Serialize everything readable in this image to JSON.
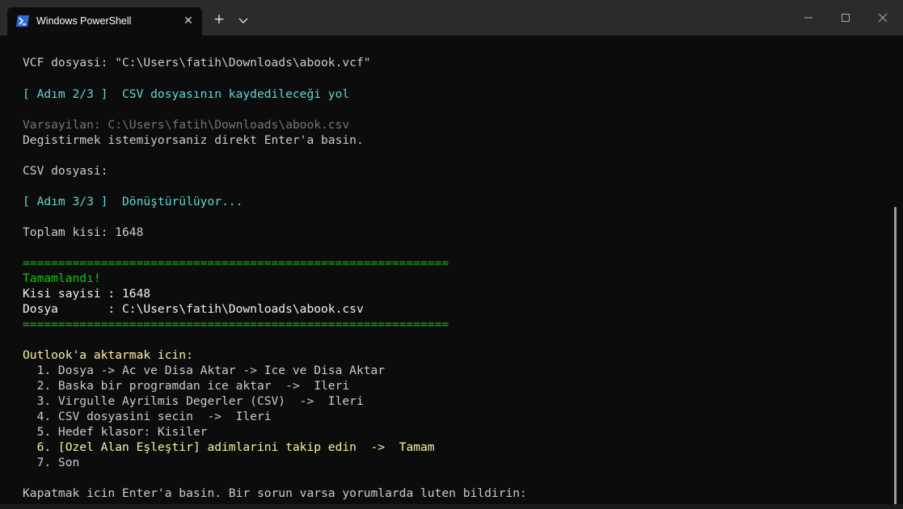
{
  "window": {
    "tab_title": "Windows PowerShell",
    "tab_icon": "powershell-icon",
    "close_tab_glyph": "✕",
    "new_tab_glyph": "+"
  },
  "terminal": {
    "lines": [
      "VCF dosyasi: \"C:\\Users\\fatih\\Downloads\\abook.vcf\"",
      "[ Adım 2/3 ]  CSV dosyasının kaydedileceği yol",
      "Varsayilan: C:\\Users\\fatih\\Downloads\\abook.csv",
      "Degistirmek istemiyorsaniz direkt Enter'a basin.",
      "CSV dosyasi:",
      "[ Adım 3/3 ]  Dönüştürülüyor...",
      "Toplam kisi: 1648",
      "============================================================",
      "Tamamlandı!",
      "Kisi sayisi : 1648",
      "Dosya       : C:\\Users\\fatih\\Downloads\\abook.csv",
      "============================================================",
      "Outlook'a aktarmak icin:",
      "  1. Dosya -> Ac ve Disa Aktar -> Ice ve Disa Aktar",
      "  2. Baska bir programdan ice aktar  ->  Ileri",
      "  3. Virgulle Ayrilmis Degerler (CSV)  ->  Ileri",
      "  4. CSV dosyasini secin  ->  Ileri",
      "  5. Hedef klasor: Kisiler",
      "  6. [Ozel Alan Eşleştir] adimlarini takip edin  ->  Tamam",
      "  7. Son",
      "Kapatmak icin Enter'a basin. Bir sorun varsa yorumlarda luten bildirin:"
    ]
  },
  "colors": {
    "background": "#0c0c0c",
    "default_text": "#cccccc",
    "cyan": "#61d6d6",
    "gray": "#767676",
    "green": "#16c60c",
    "yellow": "#f9f1a5",
    "titlebar": "#2b2b2b"
  }
}
